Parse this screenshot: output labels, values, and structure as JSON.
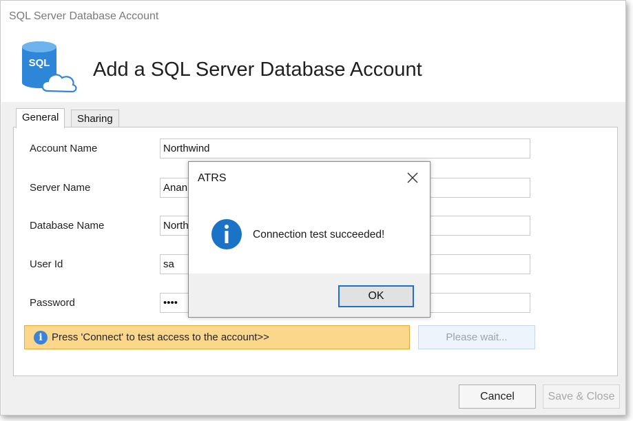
{
  "window": {
    "title": "SQL Server Database Account",
    "header_title": "Add a SQL Server Database Account",
    "icon_text": "SQL"
  },
  "tabs": [
    {
      "label": "General",
      "active": true
    },
    {
      "label": "Sharing",
      "active": false
    }
  ],
  "form": {
    "account_name_label": "Account Name",
    "account_name_value": "Northwind",
    "server_name_label": "Server Name",
    "server_name_value": "Anan",
    "database_name_label": "Database Name",
    "database_name_value": "North",
    "user_id_label": "User Id",
    "user_id_value": "sa",
    "password_label": "Password",
    "password_value": "••••"
  },
  "info_bar": {
    "icon": "info-icon",
    "text": "Press 'Connect' to test access to the account>>"
  },
  "wait_button": "Please wait...",
  "footer": {
    "cancel": "Cancel",
    "save_close": "Save & Close"
  },
  "dialog": {
    "title": "ATRS",
    "message": "Connection test succeeded!",
    "ok": "OK",
    "icon": "info-icon"
  },
  "colors": {
    "info_bar_bg": "#fbd78c",
    "info_icon": "#1b73c8",
    "db_icon": "#2e86d8",
    "ok_border": "#1e6fd0"
  }
}
